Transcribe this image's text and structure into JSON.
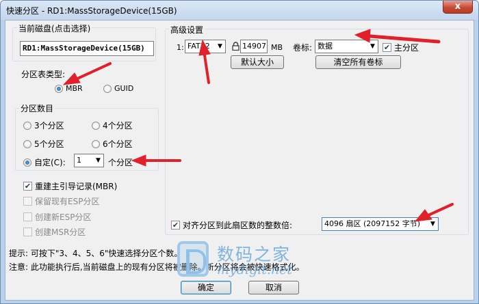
{
  "window": {
    "title": "快速分区 - RD1:MassStorageDevice(15GB)",
    "close_label": "x"
  },
  "disk_group": {
    "label": "当前磁盘(点击选择)",
    "disk_name": "RD1:MassStorageDevice(15GB)"
  },
  "partition_table": {
    "label": "分区表类型:",
    "options": [
      {
        "label": "MBR",
        "selected": true
      },
      {
        "label": "GUID",
        "selected": false
      }
    ]
  },
  "partition_count": {
    "label": "分区数目",
    "options": [
      {
        "label": "3个分区",
        "selected": false
      },
      {
        "label": "4个分区",
        "selected": false
      },
      {
        "label": "5个分区",
        "selected": false
      },
      {
        "label": "6个分区",
        "selected": false
      }
    ],
    "custom": {
      "label": "自定(C):",
      "selected": true,
      "value": "1",
      "suffix": "个分区"
    }
  },
  "options": [
    {
      "label": "重建主引导记录(MBR)",
      "checked": true,
      "enabled": true
    },
    {
      "label": "保留现有ESP分区",
      "checked": false,
      "enabled": false
    },
    {
      "label": "创建新ESP分区",
      "checked": false,
      "enabled": false
    },
    {
      "label": "创建MSR分区",
      "checked": false,
      "enabled": false
    }
  ],
  "advanced": {
    "label": "高级设置",
    "row_index": "1:",
    "fs": "FAT32",
    "size": "14907",
    "size_unit": "MB",
    "volume_label_caption": "卷标:",
    "volume_label": "数据",
    "primary_label": "主分区",
    "primary_checked": true,
    "default_size_button": "默认大小",
    "clear_labels_button": "清空所有卷标"
  },
  "align": {
    "label": "对齐分区到此扇区数的整数倍:",
    "checked": true,
    "value": "4096 扇区 (2097152 字节)"
  },
  "hints": {
    "tip": "提示: 可按下\"3、4、5、6\"快速选择分区个数。",
    "note": "注意: 此功能执行后,当前磁盘上的现有分区将被删除。新分区将会被快速格式化。"
  },
  "buttons": {
    "ok": "确定",
    "cancel": "取消"
  },
  "watermark": {
    "cn": "数码之家",
    "en": "mydigit.net"
  },
  "colors": {
    "arrow_red": "#e0202a",
    "title_bg": "#c3d6ec",
    "close_red": "#c74a35"
  }
}
